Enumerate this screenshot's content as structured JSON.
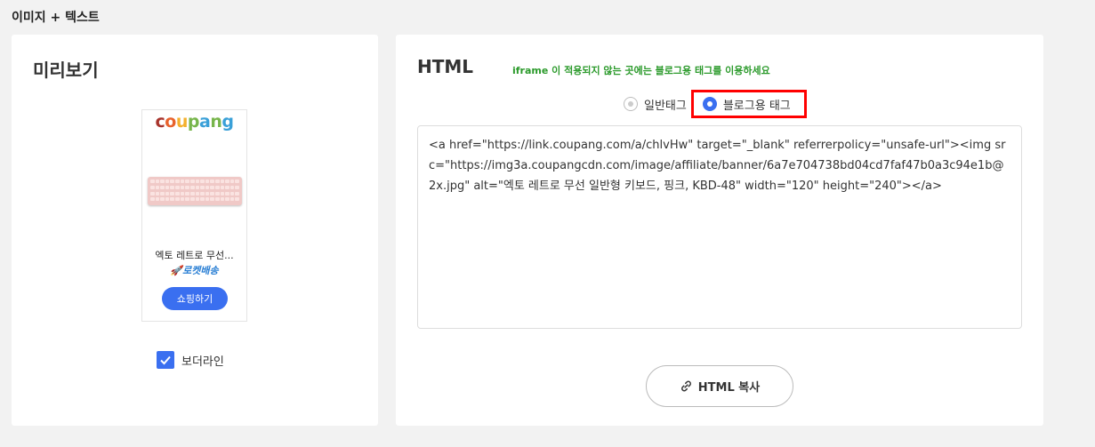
{
  "section_title": "이미지 + 텍스트",
  "preview": {
    "heading": "미리보기",
    "banner": {
      "logo": [
        "c",
        "o",
        "u",
        "p",
        "a",
        "n",
        "g"
      ],
      "product_name": "엑토 레트로 무선...",
      "rocket_label": "🚀로켓배송",
      "shop_button": "쇼핑하기"
    },
    "border_line": {
      "label": "보더라인",
      "checked": true
    }
  },
  "html_panel": {
    "heading": "HTML",
    "notice": "iframe 이 적용되지 않는 곳에는 블로그용 태그를 이용하세요",
    "radio_options": [
      {
        "label": "일반태그",
        "selected": false
      },
      {
        "label": "블로그용 태그",
        "selected": true
      }
    ],
    "code": "<a href=\"https://link.coupang.com/a/chlvHw\" target=\"_blank\" referrerpolicy=\"unsafe-url\"><img src=\"https://img3a.coupangcdn.com/image/affiliate/banner/6a7e704738bd04cd7faf47b0a3c94e1b@2x.jpg\" alt=\"엑토 레트로 무선 일반형 키보드, 핑크, KBD-48\" width=\"120\" height=\"240\"></a>",
    "copy_button": "HTML 복사"
  },
  "colors": {
    "accent": "#3a6ff0",
    "notice": "#2b9a2b",
    "highlight_border": "#ff0000"
  }
}
